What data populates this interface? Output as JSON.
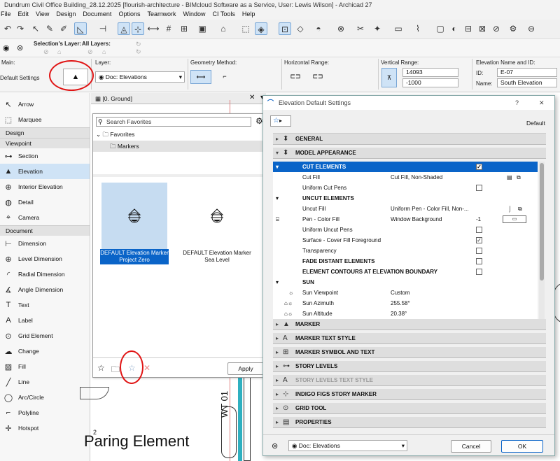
{
  "window": {
    "title": "Dundrum Civil Office Building_28.12.2025 [flourish-architecture - BIMcloud Software as a Service, User: Lewis Wilson] - Archicad 27"
  },
  "menu": [
    "File",
    "Edit",
    "View",
    "Design",
    "Document",
    "Options",
    "Teamwork",
    "Window",
    "CI Tools",
    "Help"
  ],
  "selection_bar": {
    "selections_layer": "Selection's Layer:",
    "all_layers": "All Layers:"
  },
  "info_box": {
    "main_label": "Main:",
    "main_value": "Default Settings",
    "layer_label": "Layer:",
    "layer_value": "Doc: Elevations",
    "geometry_label": "Geometry Method:",
    "horizontal_label": "Horizontal Range:",
    "vertical_label": "Vertical Range:",
    "vertical_top": "14093",
    "vertical_bottom": "-1000",
    "elev_label": "Elevation Name and ID:",
    "id_label": "ID:",
    "id_value": "E-07",
    "name_label": "Name:",
    "name_value": "South Elevation"
  },
  "toolbox": {
    "arrow": "Arrow",
    "marquee": "Marquee",
    "design_group": "Design",
    "viewpoint_group": "Viewpoint",
    "viewpoint": [
      "Section",
      "Elevation",
      "Interior Elevation",
      "Detail",
      "Camera"
    ],
    "document_group": "Document",
    "document": [
      "Dimension",
      "Level Dimension",
      "Radial Dimension",
      "Angle Dimension",
      "Text",
      "Label",
      "Grid Element",
      "Change",
      "Fill",
      "Line",
      "Arc/Circle",
      "Polyline",
      "Hotspot"
    ]
  },
  "canvas": {
    "tab_label": "[0. Ground]",
    "wall_tag": "WT 01",
    "bottom_text": "Paring Element",
    "annot": "2"
  },
  "favorites": {
    "search_placeholder": "Search Favorites",
    "folder_root": "Favorites",
    "folder_sub": "Markers",
    "items": [
      {
        "line1": "DEFAULT Elevation Marker",
        "line2": "Project Zero"
      },
      {
        "line1": "DEFAULT Elevation Marker",
        "line2": "Sea Level"
      }
    ],
    "apply_label": "Apply"
  },
  "dialog": {
    "title": "Elevation Default Settings",
    "help": "?",
    "close": "✕",
    "default_label": "Default",
    "sections_top": [
      "GENERAL",
      "MODEL APPEARANCE"
    ],
    "cut_elements": "CUT ELEMENTS",
    "cut_fill_label": "Cut Fill",
    "cut_fill_value": "Cut Fill, Non-Shaded",
    "uniform_cut_pens": "Uniform Cut Pens",
    "uncut_elements": "UNCUT ELEMENTS",
    "uncut_fill_label": "Uncut Fill",
    "uncut_fill_value": "Uniform Pen - Color Fill, Non-...",
    "pen_color_label": "Pen - Color Fill",
    "pen_color_value": "Window Background",
    "pen_num": "-1",
    "uniform_uncut_pens": "Uniform Uncut Pens",
    "surface_cover": "Surface - Cover Fill Foreground",
    "transparency": "Transparency",
    "fade_distant": "FADE DISTANT ELEMENTS",
    "contours": "ELEMENT CONTOURS AT ELEVATION BOUNDARY",
    "sun": "SUN",
    "sun_viewpoint_label": "Sun Viewpoint",
    "sun_viewpoint_value": "Custom",
    "sun_azimuth_label": "Sun Azimuth",
    "sun_azimuth_value": "255.58°",
    "sun_altitude_label": "Sun Altitude",
    "sun_altitude_value": "20.38°",
    "sections_bottom": [
      "MARKER",
      "MARKER TEXT STYLE",
      "MARKER SYMBOL AND TEXT",
      "STORY LEVELS",
      "STORY LEVELS TEXT STYLE",
      "INDIGO FIGS STORY MARKER",
      "GRID TOOL",
      "PROPERTIES"
    ],
    "footer_layer": "Doc: Elevations",
    "cancel": "Cancel",
    "ok": "OK"
  },
  "colors": {
    "accent": "#0a64c8",
    "selection": "#cfe3f6",
    "annotation": "#e01414"
  }
}
